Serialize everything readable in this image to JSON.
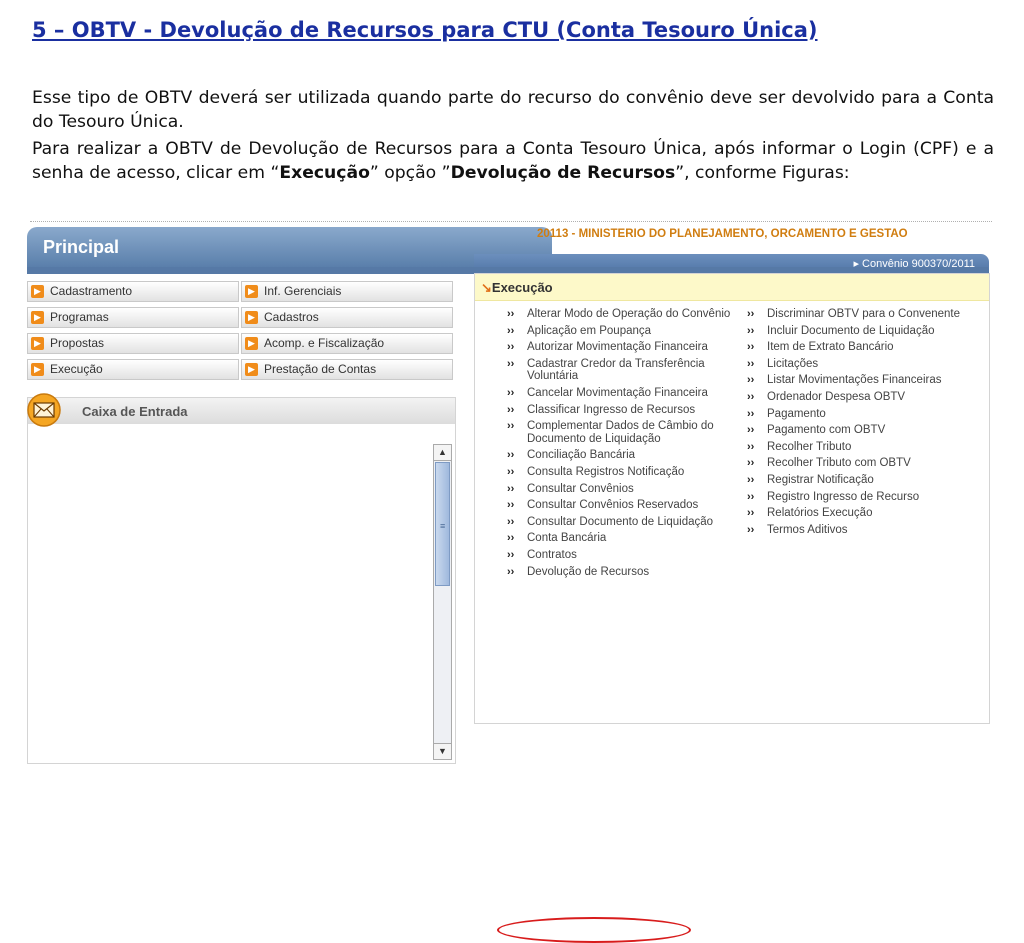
{
  "slide": {
    "title": "5  – OBTV - Devolução de Recursos para CTU (Conta Tesouro Única)",
    "p1": "Esse tipo de OBTV deverá ser utilizada quando parte do recurso do convênio deve ser devolvido para a Conta do Tesouro Única.",
    "p2_a": " Para realizar a OBTV de Devolução de Recursos para a Conta Tesouro Única, após informar o Login (CPF) e a senha de acesso, clicar em “",
    "p2_b": "Execução",
    "p2_c": "” opção ”",
    "p2_d": "Devolução de Recursos",
    "p2_e": "”, conforme Figuras:"
  },
  "app": {
    "tab_title": "Principal",
    "org": "20113 - MINISTERIO DO PLANEJAMENTO, ORCAMENTO E GESTAO",
    "convenio": "▸ Convênio 900370/2011",
    "menu": [
      {
        "label": "Cadastramento"
      },
      {
        "label": "Inf. Gerenciais"
      },
      {
        "label": "Programas"
      },
      {
        "label": "Cadastros"
      },
      {
        "label": "Propostas"
      },
      {
        "label": "Acomp. e Fiscalização"
      },
      {
        "label": "Execução"
      },
      {
        "label": "Prestação de Contas"
      }
    ],
    "inbox_title": "Caixa de Entrada",
    "exec_title": "Execução",
    "exec_col1": [
      {
        "label": "Alterar Modo de Operação do Convênio"
      },
      {
        "label": "Aplicação em Poupança"
      },
      {
        "label": "Autorizar Movimentação Financeira"
      },
      {
        "label": "Cadastrar Credor da Transferência Voluntária"
      },
      {
        "label": "Cancelar Movimentação Financeira"
      },
      {
        "label": "Classificar Ingresso de Recursos"
      },
      {
        "label": "Complementar Dados de Câmbio do Documento de Liquidação"
      },
      {
        "label": "Conciliação Bancária"
      },
      {
        "label": "Consulta Registros Notificação"
      },
      {
        "label": "Consultar Convênios"
      },
      {
        "label": "Consultar Convênios Reservados"
      },
      {
        "label": "Consultar Documento de Liquidação"
      },
      {
        "label": "Conta Bancária"
      },
      {
        "label": "Contratos"
      },
      {
        "label": "Devolução de Recursos"
      }
    ],
    "exec_col2": [
      {
        "label": "Discriminar OBTV para o Convenente"
      },
      {
        "label": "Incluir Documento de Liquidação"
      },
      {
        "label": "Item de Extrato Bancário"
      },
      {
        "label": "Licitações"
      },
      {
        "label": "Listar Movimentações Financeiras"
      },
      {
        "label": "Ordenador Despesa OBTV"
      },
      {
        "label": "Pagamento"
      },
      {
        "label": "Pagamento com OBTV"
      },
      {
        "label": "Recolher Tributo"
      },
      {
        "label": "Recolher Tributo com OBTV"
      },
      {
        "label": "Registrar Notificação"
      },
      {
        "label": "Registro Ingresso de Recurso"
      },
      {
        "label": "Relatórios Execução"
      },
      {
        "label": "Termos Aditivos"
      }
    ],
    "colors": {
      "accent_orange": "#f08c1a",
      "header_blue": "#5679a6",
      "org_text": "#d07d10",
      "highlight_red": "#d81c1c"
    }
  }
}
